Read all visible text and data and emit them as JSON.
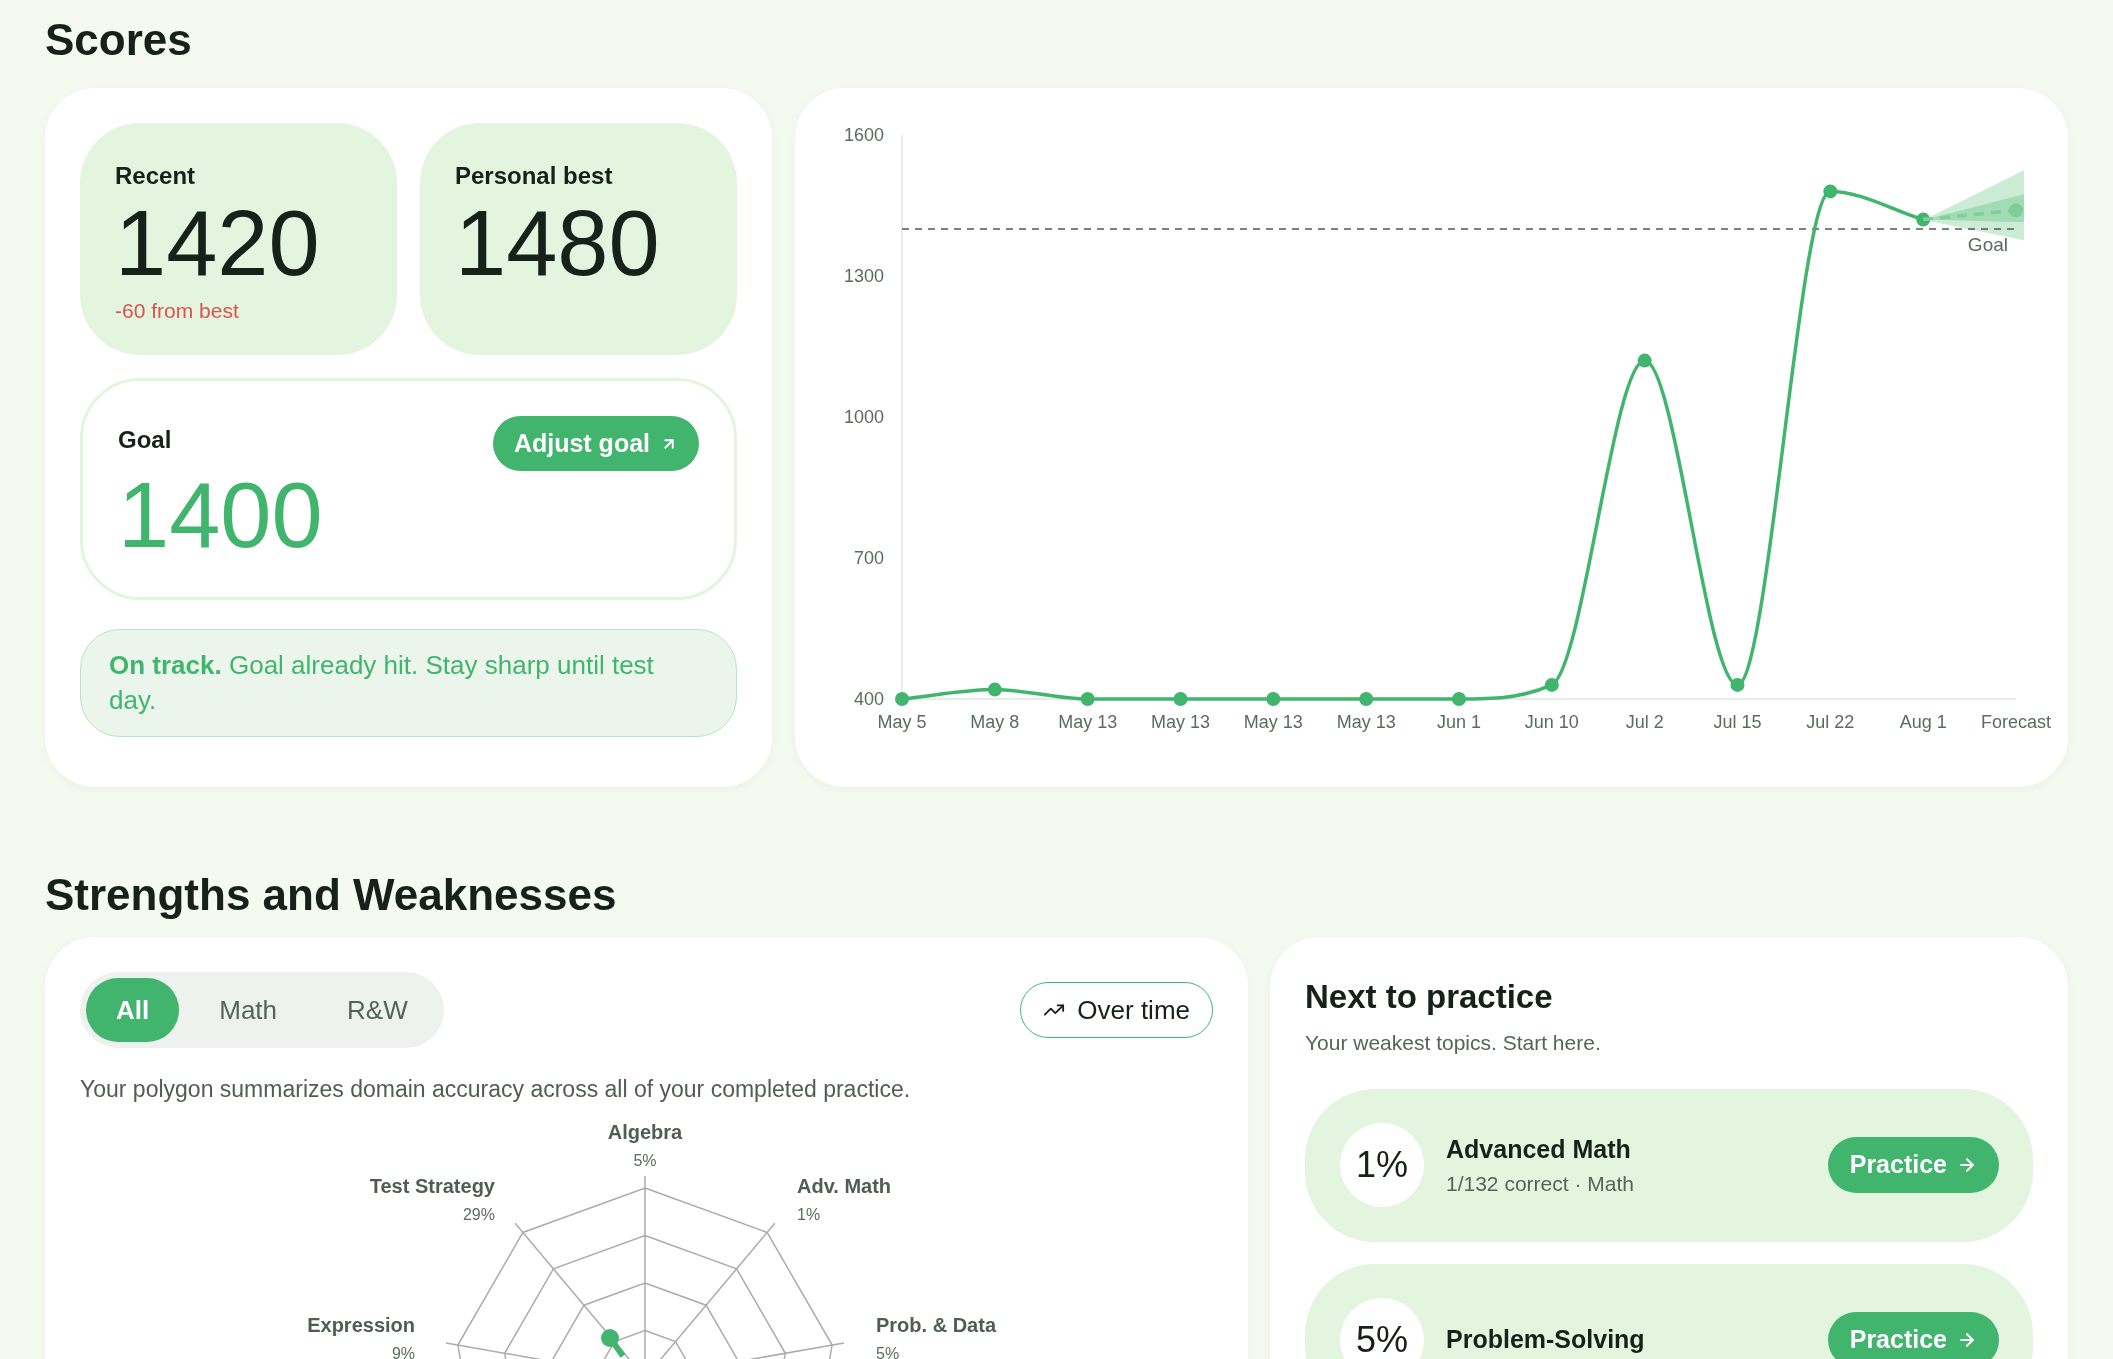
{
  "scores": {
    "title": "Scores",
    "recent": {
      "label": "Recent",
      "value": "1420",
      "delta": "-60 from best"
    },
    "personal_best": {
      "label": "Personal best",
      "value": "1480"
    },
    "goal": {
      "label": "Goal",
      "value": "1400",
      "button": "Adjust goal"
    },
    "status": "**On track.** Goal already hit. Stay sharp until test day.",
    "chart_data": {
      "type": "line",
      "categories": [
        "May 5",
        "May 8",
        "May 13",
        "May 13",
        "May 13",
        "May 13",
        "Jun 1",
        "Jun 10",
        "Jul 2",
        "Jul 15",
        "Jul 22",
        "Aug 1",
        "Forecast"
      ],
      "series": [
        {
          "color": "#41b56d",
          "marker": "circle",
          "values": [
            400,
            420,
            400,
            400,
            400,
            400,
            400,
            430,
            1120,
            430,
            1480,
            1420,
            null
          ]
        },
        {
          "color": "#7fcf9b",
          "line_style": "dashed",
          "values": [
            null,
            null,
            null,
            null,
            null,
            null,
            null,
            null,
            null,
            null,
            null,
            1420,
            1440
          ]
        }
      ],
      "ylim": [
        400,
        1600
      ],
      "yticks": [
        400,
        700,
        1000,
        1300,
        1600
      ],
      "ref_lines": [
        {
          "axis": "y",
          "value": 1400,
          "label": "Goal"
        }
      ]
    }
  },
  "strengths": {
    "title": "Strengths and Weaknesses",
    "filters": [
      {
        "label": "All",
        "selected": true
      },
      {
        "label": "Math",
        "selected": false
      },
      {
        "label": "R&W",
        "selected": false
      }
    ],
    "over_time_button": "Over time",
    "description": "Your polygon summarizes domain accuracy across all of your completed practice.",
    "radar_axes": [
      {
        "label": "Algebra",
        "value": "5%"
      },
      {
        "label": "Test Strategy",
        "value": "29%"
      },
      {
        "label": "Adv. Math",
        "value": "1%"
      },
      {
        "label": "Expression",
        "value": "9%"
      },
      {
        "label": "Prob. & Data",
        "value": "5%"
      }
    ]
  },
  "next_to_practice": {
    "title": "Next to practice",
    "subtitle": "Your weakest topics. Start here.",
    "topics": [
      {
        "percent": "1%",
        "name": "Advanced Math",
        "detail": "1/132 correct · Math",
        "button": "Practice"
      },
      {
        "percent": "5%",
        "name": "Problem-Solving",
        "button": "Practice"
      }
    ]
  }
}
